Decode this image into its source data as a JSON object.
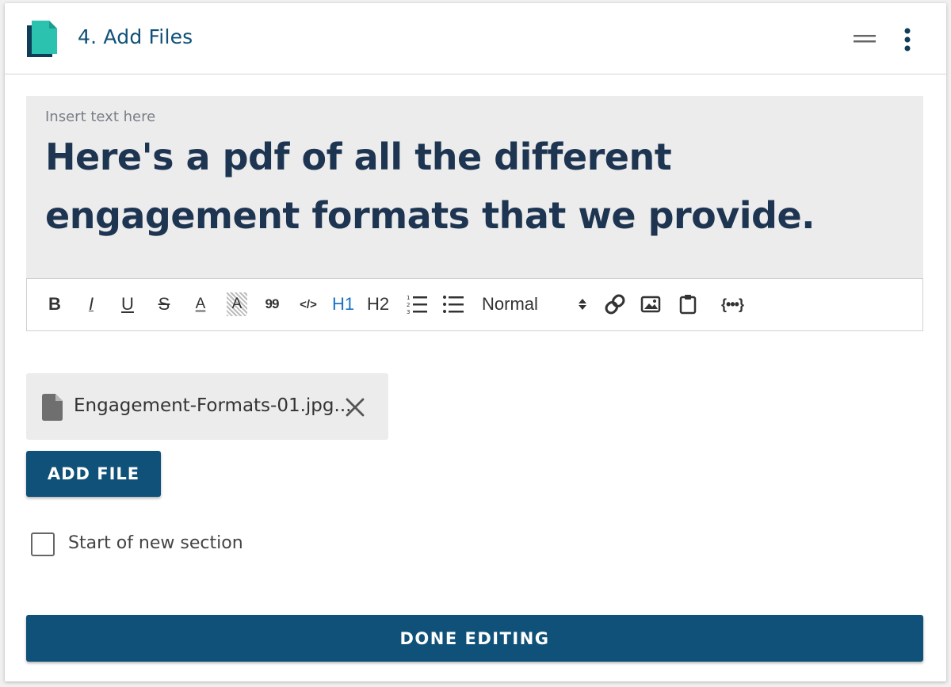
{
  "header": {
    "title": "4. Add Files",
    "icon": "document-icon",
    "icon_colors": {
      "front": "#2bc2b0",
      "back": "#0f3c57"
    }
  },
  "editor": {
    "placeholder": "Insert text here",
    "content": "Here's a pdf of all the different engagement formats that we provide."
  },
  "toolbar": {
    "bold": "B",
    "italic": "I",
    "underline": "U",
    "strike": "S",
    "font_color": "A",
    "highlight": "A",
    "quote": "99",
    "code": "</>",
    "h1": "H1",
    "h2": "H2",
    "block_type": "Normal",
    "variables": "{•••}"
  },
  "files": [
    {
      "name": "Engagement-Formats-01.jpg..."
    }
  ],
  "actions": {
    "add_file": "ADD FILE",
    "done": "DONE EDITING"
  },
  "section": {
    "label": "Start of new section",
    "checked": false
  },
  "colors": {
    "primary": "#0f5178",
    "title_text": "#0f5178",
    "heading_text": "#1e3552",
    "active_heading": "#1a73c9"
  }
}
